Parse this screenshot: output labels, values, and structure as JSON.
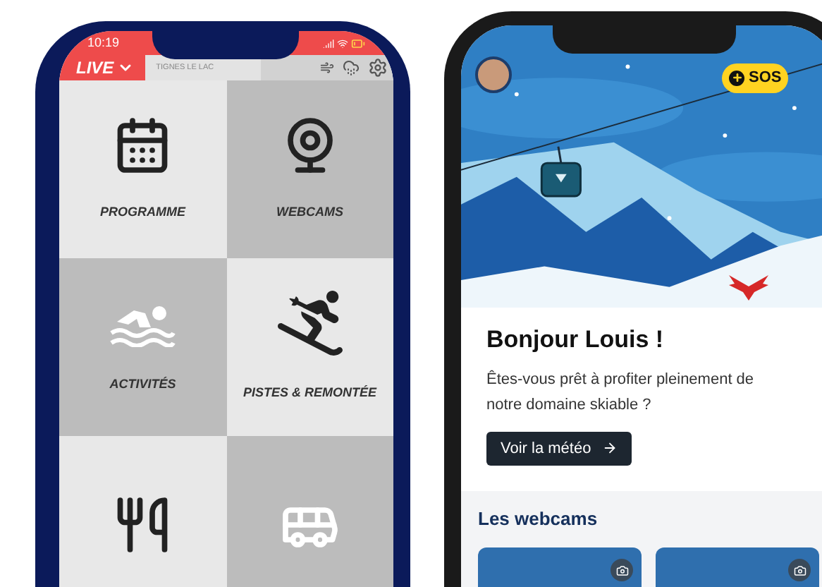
{
  "left_phone": {
    "status_bar": {
      "time": "10:19"
    },
    "header": {
      "live_label": "LIVE",
      "resort": "TIGNES LE LAC"
    },
    "tiles": [
      {
        "kind": "calendar",
        "label": "PROGRAMME"
      },
      {
        "kind": "webcam",
        "label": "WEBCAMS"
      },
      {
        "kind": "swimmer",
        "label": "ACTIVITÉS"
      },
      {
        "kind": "skier",
        "label": "PISTES & REMONTÉE"
      },
      {
        "kind": "cutlery"
      },
      {
        "kind": "bus"
      }
    ]
  },
  "right_phone": {
    "sos_label": "SOS",
    "greeting": "Bonjour Louis !",
    "message": "Êtes-vous prêt à profiter pleinement de notre domaine skiable ?",
    "weather_button": "Voir la météo",
    "webcams_title": "Les webcams"
  }
}
